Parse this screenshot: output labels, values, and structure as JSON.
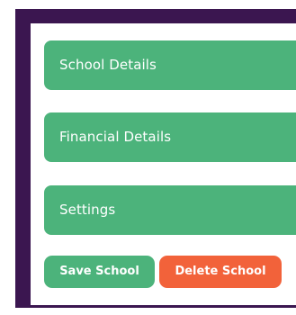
{
  "sections": [
    {
      "label": "School Details"
    },
    {
      "label": "Financial Details"
    },
    {
      "label": "Settings"
    }
  ],
  "actions": {
    "save_label": "Save School",
    "delete_label": "Delete School"
  },
  "colors": {
    "frame": "#3b1650",
    "section_green": "#4cb37b",
    "save_green": "#4cb37b",
    "delete_orange": "#f2623a"
  }
}
